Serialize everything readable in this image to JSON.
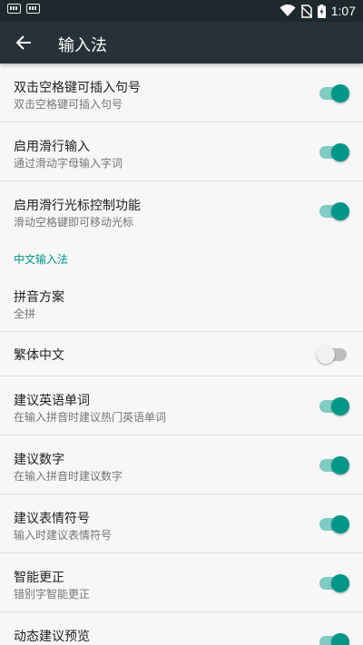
{
  "status_bar": {
    "time": "1:07",
    "left_icons": [
      "keyboard-icon",
      "keyboard-icon"
    ],
    "right_icons": [
      "wifi-icon",
      "no-sim-icon",
      "battery-charging-icon"
    ]
  },
  "app_bar": {
    "title": "输入法",
    "back_icon": "arrow-back-icon",
    "background": "#263238"
  },
  "colors": {
    "accent": "#009688",
    "accent_track": "#80cbc4"
  },
  "settings_top": [
    {
      "title": "双击空格键可插入句号",
      "subtitle": "双击空格键可插入句号",
      "toggle": true
    },
    {
      "title": "启用滑行输入",
      "subtitle": "通过滑动字母输入字词",
      "toggle": true
    },
    {
      "title": "启用滑行光标控制功能",
      "subtitle": "滑动空格键即可移动光标",
      "toggle": true
    }
  ],
  "section_header": "中文输入法",
  "pinyin_scheme": {
    "title": "拼音方案",
    "value": "全拼"
  },
  "traditional": {
    "title": "繁体中文",
    "toggle": false
  },
  "settings_bottom": [
    {
      "title": "建议英语单词",
      "subtitle": "在输入拼音时建议热门英语单词",
      "toggle": true
    },
    {
      "title": "建议数字",
      "subtitle": "在输入拼音时建议数字",
      "toggle": true
    },
    {
      "title": "建议表情符号",
      "subtitle": "输入时建议表情符号",
      "toggle": true
    },
    {
      "title": "智能更正",
      "subtitle": "错别字智能更正",
      "toggle": true
    },
    {
      "title": "动态建议预览",
      "subtitle": "",
      "toggle": true
    }
  ]
}
